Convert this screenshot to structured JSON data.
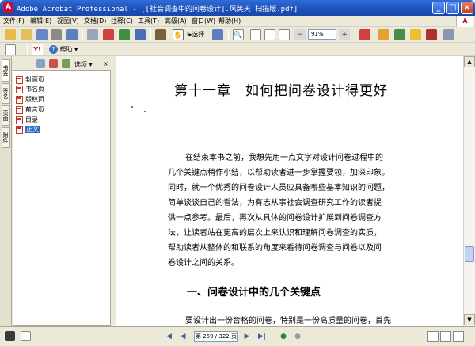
{
  "window": {
    "title": "Adobe Acrobat Professional - [[社会调查中的问卷设计].风笑天.扫描版.pdf]",
    "app_icon": "acrobat-icon",
    "buttons": [
      "minimize-icon",
      "maximize-icon",
      "close-icon"
    ]
  },
  "menu": {
    "items": [
      "文件(F)",
      "编辑(E)",
      "视图(V)",
      "文档(D)",
      "注释(C)",
      "工具(T)",
      "高级(A)",
      "窗口(W)",
      "帮助(H)"
    ]
  },
  "toolbar": {
    "select_label": "选择",
    "zoom_value": "91%",
    "help_label": "帮助"
  },
  "sidebar": {
    "tabs": [
      "书签",
      "签名",
      "页面",
      "附件"
    ],
    "options_label": "选项",
    "bookmarks": [
      {
        "label": "封面页",
        "selected": false
      },
      {
        "label": "书名页",
        "selected": false
      },
      {
        "label": "版权页",
        "selected": false
      },
      {
        "label": "前言页",
        "selected": false
      },
      {
        "label": "目录",
        "selected": false
      },
      {
        "label": "正文",
        "selected": true
      }
    ]
  },
  "document": {
    "chapter_title": "第十一章　如何把问卷设计得更好",
    "intro_lines": [
      "在结束本书之前，我想先用一点文字对设计问卷过程中的",
      "几个关键点稍作小结，以帮助读者进一步掌握要领，加深印象。",
      "同时，就一个优秀的问卷设计人员应具备哪些基本知识的问题，",
      "简单谈谈自己的看法，为有志从事社会调查研究工作的读者提",
      "供一点参考。最后，再次从具体的问卷设计扩展到问卷调查方",
      "法，让读者站在更高的层次上来认识和理解问卷调查的实质，",
      "帮助读者从整体的和联系的角度来看待问卷调查与问卷以及问",
      "卷设计之间的关系。"
    ],
    "section_title": "一、问卷设计中的几个关键点",
    "para2_line": "要设计出一份合格的问卷，特别是一份高质量的问卷，首先"
  },
  "status": {
    "page_display": "第 259 / 322 页"
  }
}
